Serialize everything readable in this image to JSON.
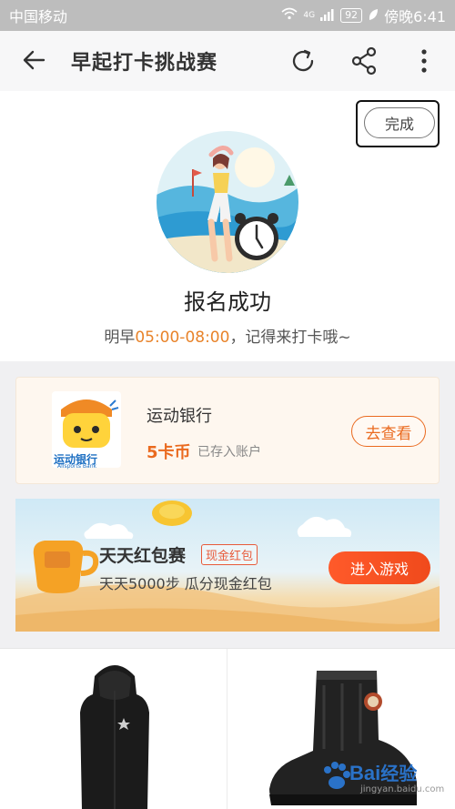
{
  "status_bar": {
    "carrier": "中国移动",
    "network": "4G",
    "battery": "92",
    "time": "傍晚6:41"
  },
  "nav": {
    "title": "早起打卡挑战赛",
    "back_icon": "arrow-left-icon",
    "refresh_icon": "refresh-icon",
    "share_icon": "share-icon",
    "more_icon": "more-vertical-icon"
  },
  "success": {
    "done_label": "完成",
    "title": "报名成功",
    "subtitle_prefix": "明早",
    "subtitle_time": "05:00-08:00",
    "subtitle_suffix": "，记得来打卡哦~"
  },
  "bank_card": {
    "logo_text": "运动银行",
    "logo_sub": "Allsports Bank",
    "name": "运动银行",
    "coins": "5卡币",
    "status": "已存入账户",
    "button": "去查看"
  },
  "game_banner": {
    "title": "天天红包赛",
    "tag": "现金红包",
    "subtitle": "天天5000步 瓜分现金红包",
    "button": "进入游戏"
  },
  "watermark": {
    "text": "Bai",
    "text2": "经验",
    "sub": "jingyan.baidu.com"
  },
  "colors": {
    "accent": "#ea6a1f",
    "time_highlight": "#e8832a",
    "game_button": "#f04a1c"
  }
}
